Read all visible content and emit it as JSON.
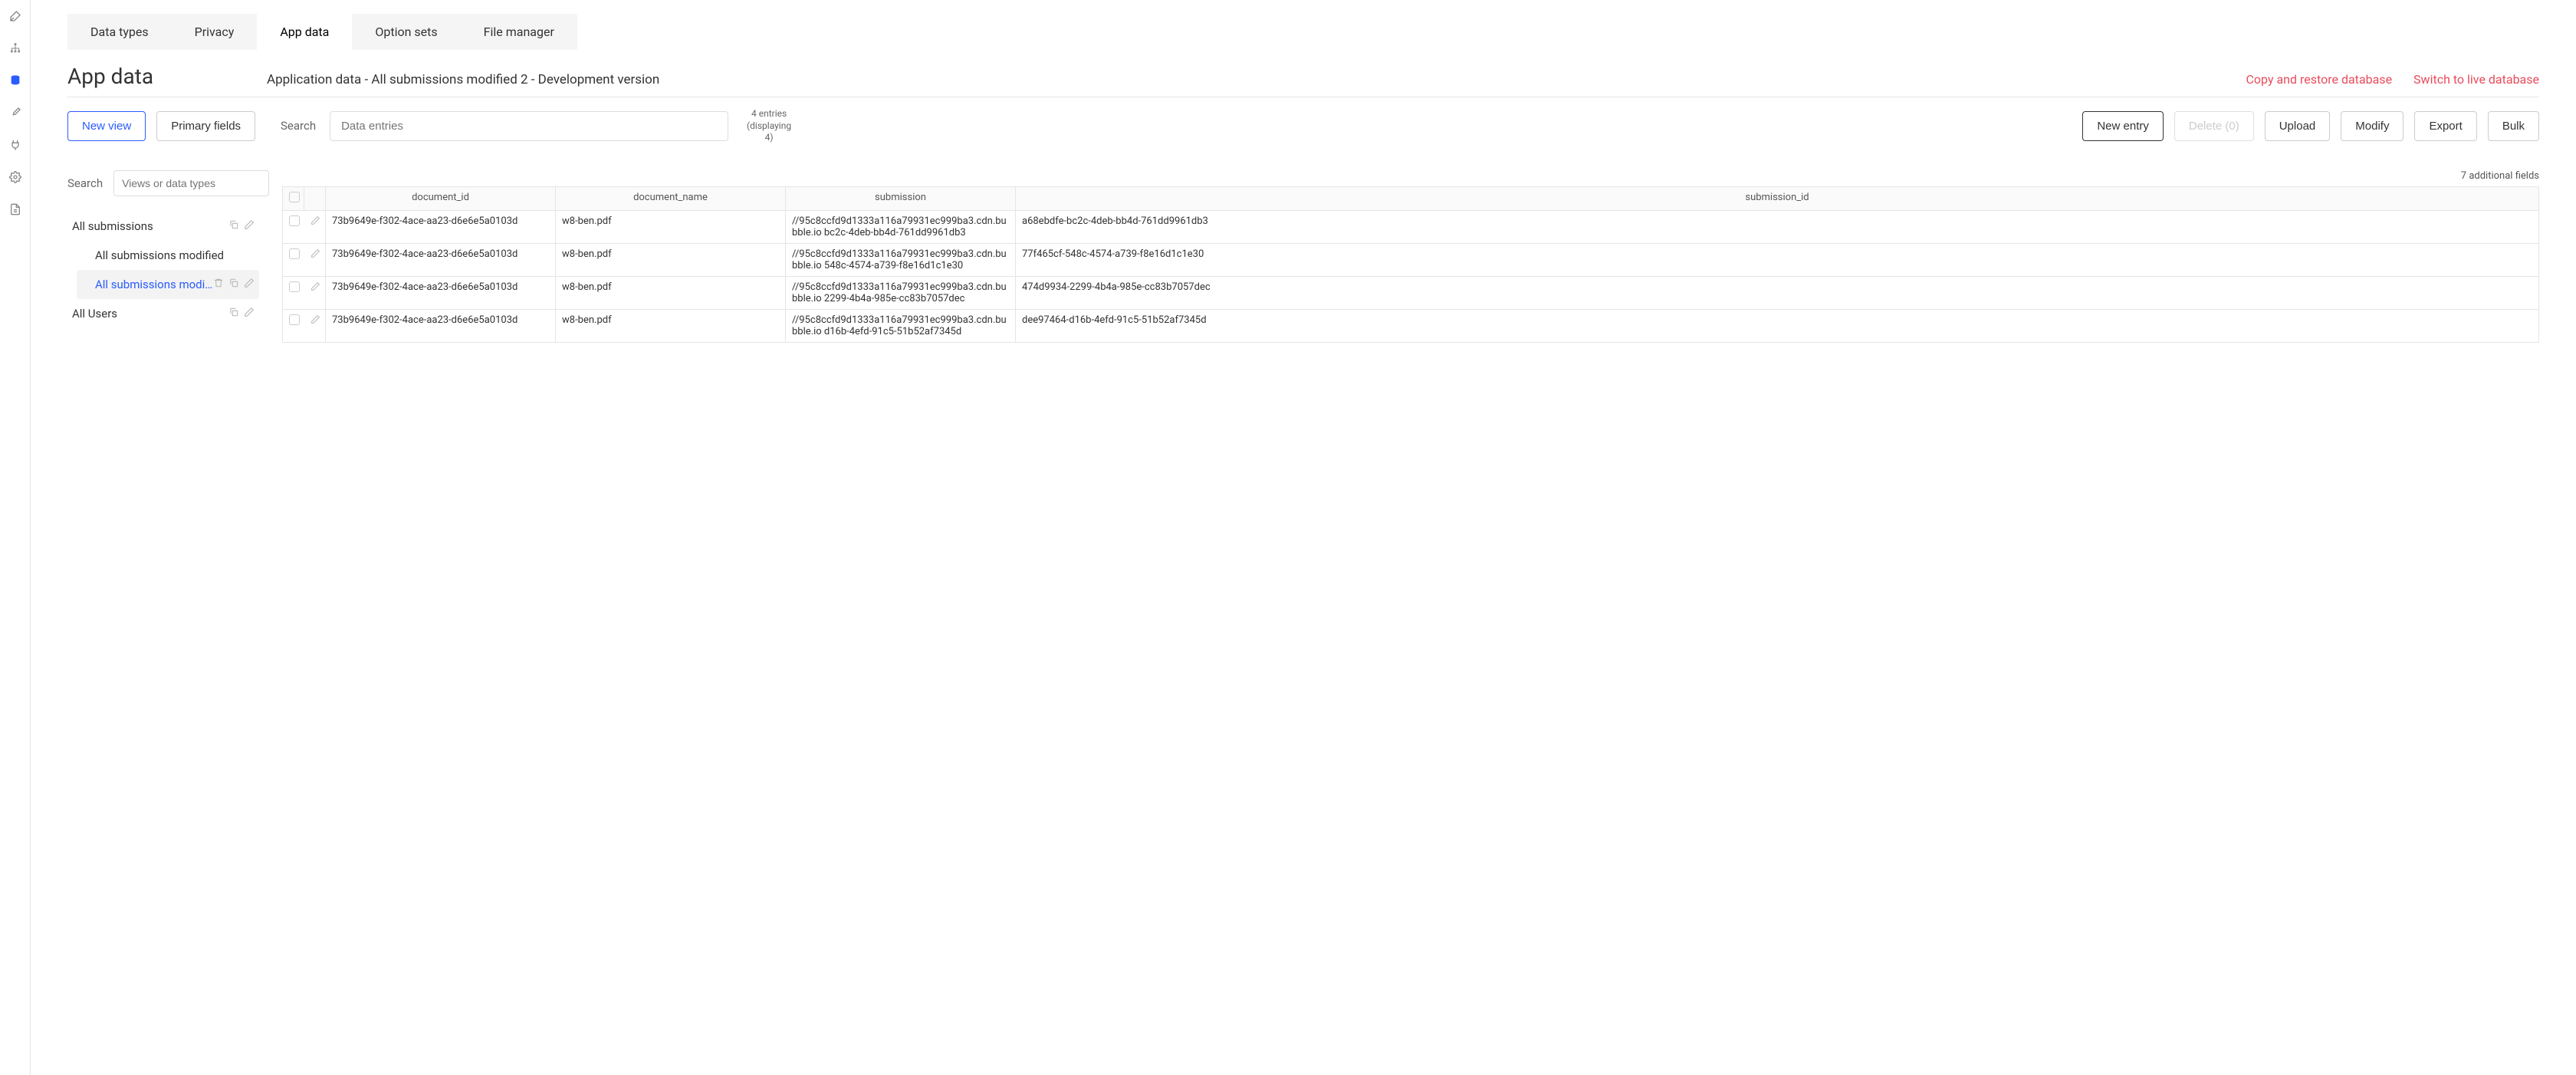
{
  "tabs": [
    {
      "label": "Data types",
      "active": false
    },
    {
      "label": "Privacy",
      "active": false
    },
    {
      "label": "App data",
      "active": true
    },
    {
      "label": "Option sets",
      "active": false
    },
    {
      "label": "File manager",
      "active": false
    }
  ],
  "page_title": "App data",
  "breadcrumb": "Application data - All submissions modified 2 - Development version",
  "header_links": {
    "copy_restore": "Copy and restore database",
    "switch_live": "Switch to live database"
  },
  "buttons": {
    "new_view": "New view",
    "primary_fields": "Primary fields",
    "new_entry": "New entry",
    "delete": "Delete (0)",
    "upload": "Upload",
    "modify": "Modify",
    "export": "Export",
    "bulk": "Bulk"
  },
  "search_label": "Search",
  "data_search_placeholder": "Data entries",
  "entry_count": "4 entries (displaying 4)",
  "side_search_label": "Search",
  "side_search_placeholder": "Views or data types",
  "tree": {
    "all_submissions": "All submissions",
    "all_submissions_modified": "All submissions modified",
    "all_submissions_modified_2": "All submissions modi...",
    "all_users": "All Users"
  },
  "additional_fields": "7 additional fields",
  "columns": {
    "document_id": "document_id",
    "document_name": "document_name",
    "submission": "submission",
    "submission_id": "submission_id"
  },
  "rows": [
    {
      "document_id": "73b9649e-f302-4ace-aa23-d6e6e5a0103d",
      "document_name": "w8-ben.pdf",
      "submission": "//95c8ccfd9d1333a116a79931ec999ba3.cdn.bubble.io bc2c-4deb-bb4d-761dd9961db3",
      "submission_id": "a68ebdfe-bc2c-4deb-bb4d-761dd9961db3"
    },
    {
      "document_id": "73b9649e-f302-4ace-aa23-d6e6e5a0103d",
      "document_name": "w8-ben.pdf",
      "submission": "//95c8ccfd9d1333a116a79931ec999ba3.cdn.bubble.io 548c-4574-a739-f8e16d1c1e30",
      "submission_id": "77f465cf-548c-4574-a739-f8e16d1c1e30"
    },
    {
      "document_id": "73b9649e-f302-4ace-aa23-d6e6e5a0103d",
      "document_name": "w8-ben.pdf",
      "submission": "//95c8ccfd9d1333a116a79931ec999ba3.cdn.bubble.io 2299-4b4a-985e-cc83b7057dec",
      "submission_id": "474d9934-2299-4b4a-985e-cc83b7057dec"
    },
    {
      "document_id": "73b9649e-f302-4ace-aa23-d6e6e5a0103d",
      "document_name": "w8-ben.pdf",
      "submission": "//95c8ccfd9d1333a116a79931ec999ba3.cdn.bubble.io d16b-4efd-91c5-51b52af7345d",
      "submission_id": "dee97464-d16b-4efd-91c5-51b52af7345d"
    }
  ]
}
